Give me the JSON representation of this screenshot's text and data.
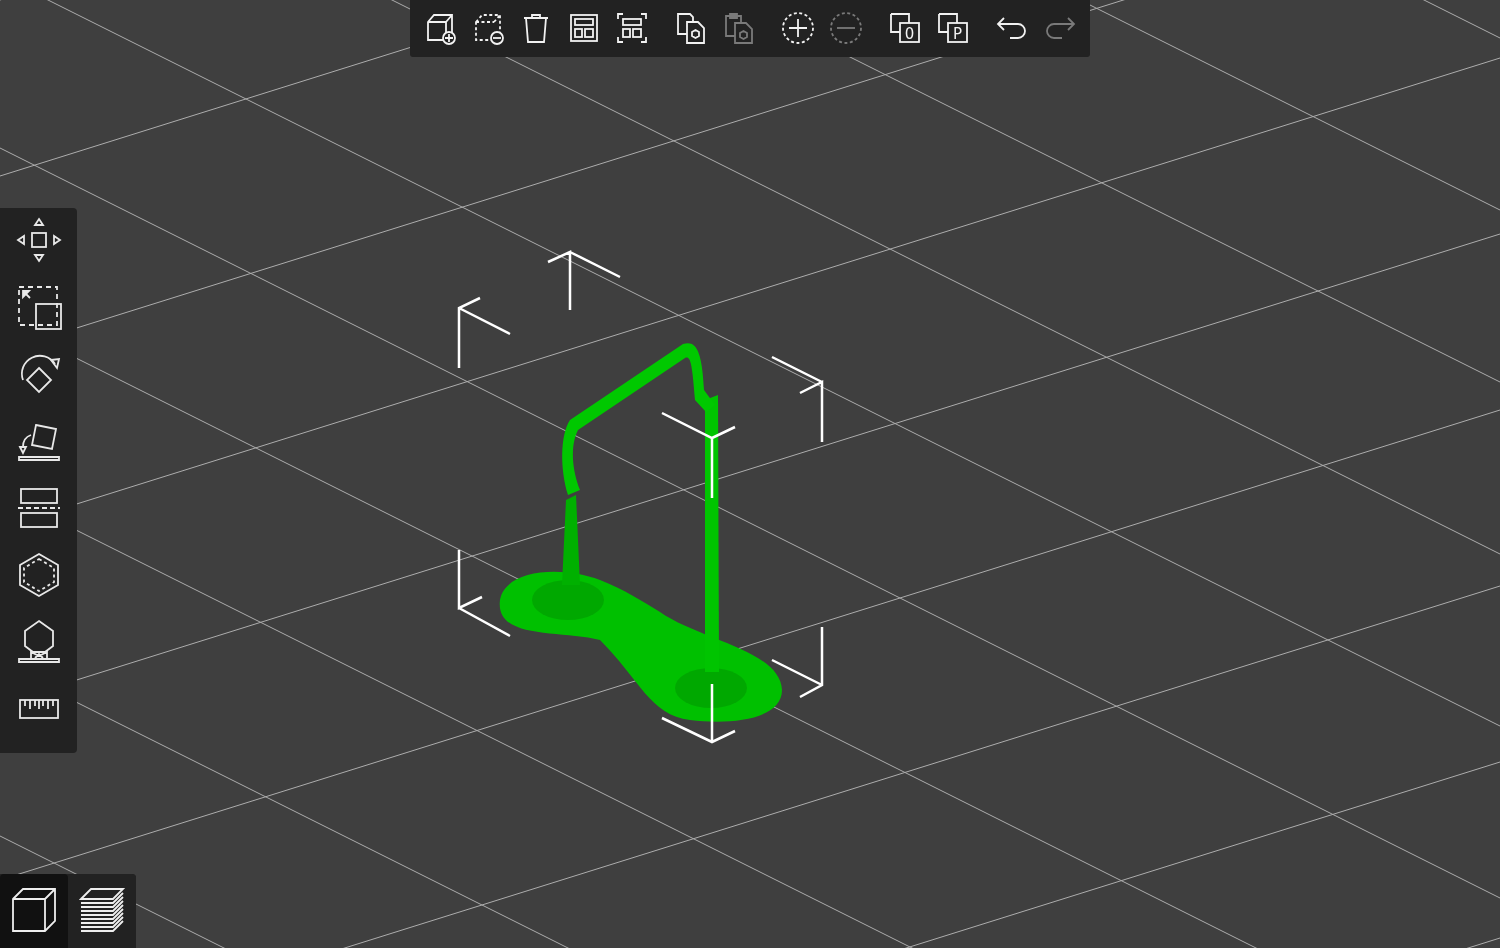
{
  "toolbar": {
    "groups": [
      [
        {
          "kind": "add",
          "disabled": false
        },
        {
          "kind": "delete",
          "disabled": false
        },
        {
          "kind": "delete_all",
          "disabled": false
        },
        {
          "kind": "arrange",
          "disabled": false
        },
        {
          "kind": "arrange_selection",
          "disabled": false
        }
      ],
      [
        {
          "kind": "copy",
          "disabled": false
        },
        {
          "kind": "paste",
          "disabled": true
        }
      ],
      [
        {
          "kind": "add_instance",
          "disabled": false
        },
        {
          "kind": "remove_instance",
          "disabled": true
        }
      ],
      [
        {
          "kind": "split",
          "label": "0",
          "disabled": false
        },
        {
          "kind": "split",
          "label": "P",
          "disabled": false
        }
      ],
      [
        {
          "kind": "undo",
          "disabled": false
        },
        {
          "kind": "redo",
          "disabled": true
        }
      ]
    ]
  },
  "gizmos": [
    {
      "kind": "move"
    },
    {
      "kind": "scale"
    },
    {
      "kind": "rotate"
    },
    {
      "kind": "place_on_face"
    },
    {
      "kind": "cut"
    },
    {
      "kind": "hollow"
    },
    {
      "kind": "supports"
    },
    {
      "kind": "measure"
    }
  ],
  "view_toggle": [
    {
      "kind": "model",
      "selected": true
    },
    {
      "kind": "preview",
      "selected": false
    }
  ]
}
